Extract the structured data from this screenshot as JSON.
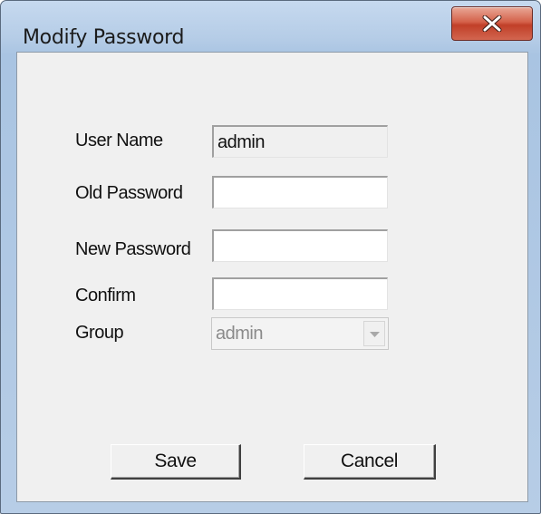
{
  "window": {
    "title": "Modify Password"
  },
  "titlebar": {
    "close_icon": "close-icon"
  },
  "form": {
    "user_name_label": "User Name",
    "user_name_value": "admin",
    "old_password_label": "Old Password",
    "old_password_value": "",
    "new_password_label": "New Password",
    "new_password_value": "",
    "confirm_label": "Confirm",
    "confirm_value": "",
    "group_label": "Group",
    "group_value": "admin"
  },
  "buttons": {
    "save_label": "Save",
    "cancel_label": "Cancel"
  }
}
